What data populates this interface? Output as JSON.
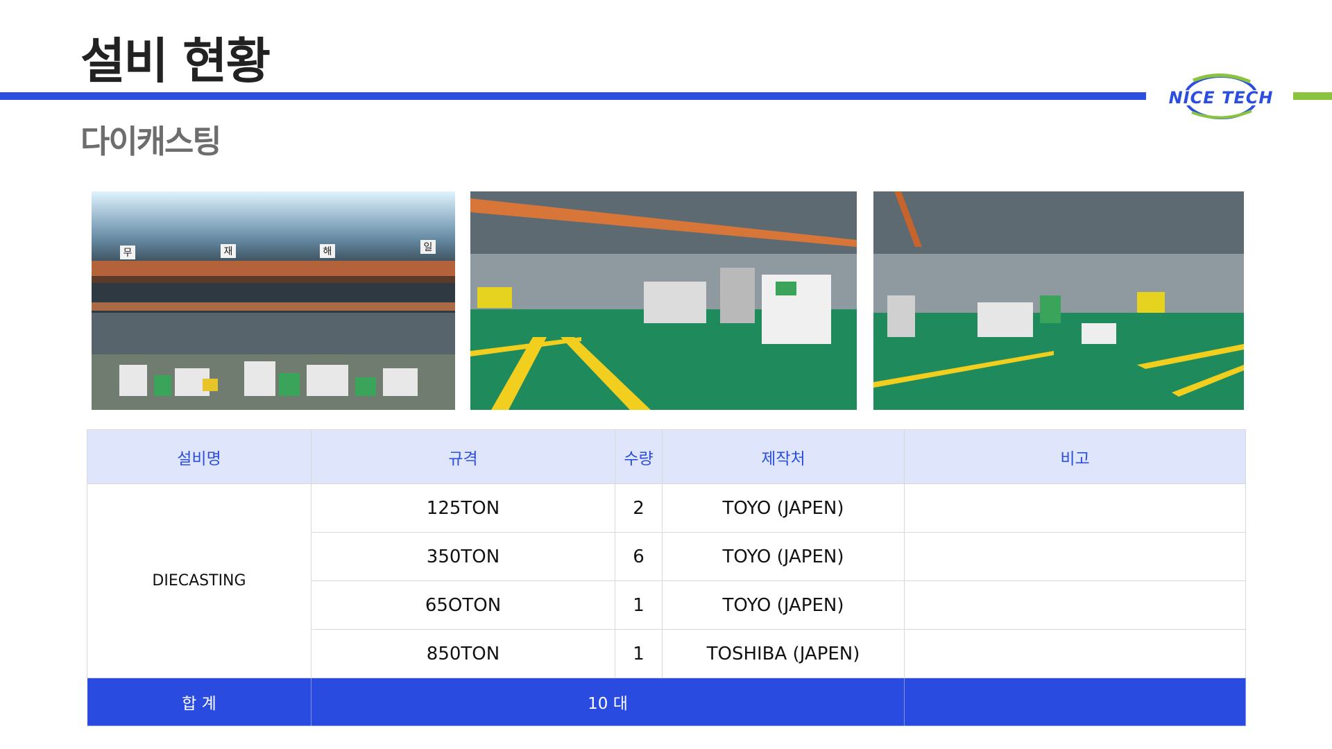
{
  "header": {
    "title": "설비 현황",
    "subtitle": "다이캐스팅",
    "logo_text_left": "NICE",
    "logo_text_right": "TECH"
  },
  "colors": {
    "accent_blue": "#2b4de0",
    "accent_green": "#8ac43f",
    "header_row_bg": "#dfe6fb",
    "total_row_bg": "#2a4be0"
  },
  "photos": [
    {
      "name": "factory-interior-photo-1",
      "sign_chars": [
        "무",
        "재",
        "해",
        "일"
      ]
    },
    {
      "name": "factory-interior-photo-2"
    },
    {
      "name": "factory-interior-photo-3"
    }
  ],
  "table": {
    "headers": [
      "설비명",
      "규격",
      "수량",
      "제작처",
      "비고"
    ],
    "equipment_name": "DIECASTING",
    "rows": [
      {
        "spec": "125TON",
        "qty": "2",
        "maker": "TOYO (JAPEN)",
        "note": ""
      },
      {
        "spec": "350TON",
        "qty": "6",
        "maker": "TOYO (JAPEN)",
        "note": ""
      },
      {
        "spec": "65OTON",
        "qty": "1",
        "maker": "TOYO (JAPEN)",
        "note": ""
      },
      {
        "spec": "850TON",
        "qty": "1",
        "maker": "TOSHIBA (JAPEN)",
        "note": ""
      }
    ],
    "total_label": "합 계",
    "total_value": "10 대",
    "total_note": ""
  }
}
